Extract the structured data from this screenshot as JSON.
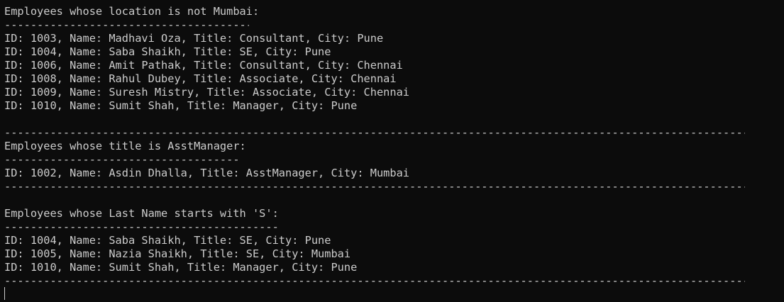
{
  "sections": {
    "not_mumbai": {
      "heading": "Employees whose location is not Mumbai:",
      "underline": "---------------------------------------",
      "rows": [
        "ID: 1003, Name: Madhavi Oza, Title: Consultant, City: Pune",
        "ID: 1004, Name: Saba Shaikh, Title: SE, City: Pune",
        "ID: 1006, Name: Amit Pathak, Title: Consultant, City: Chennai",
        "ID: 1008, Name: Rahul Dubey, Title: Associate, City: Chennai",
        "ID: 1009, Name: Suresh Mistry, Title: Associate, City: Chennai",
        "ID: 1010, Name: Sumit Shah, Title: Manager, City: Pune"
      ]
    },
    "asst_manager": {
      "heading": "Employees whose title is AsstManager:",
      "underline": "-------------------------------------",
      "rows": [
        "ID: 1002, Name: Asdin Dhalla, Title: AsstManager, City: Mumbai"
      ]
    },
    "last_name_s": {
      "heading": "Employees whose Last Name starts with 'S':",
      "underline": "------------------------------------------",
      "rows": [
        "ID: 1004, Name: Saba Shaikh, Title: SE, City: Pune",
        "ID: 1005, Name: Nazia Shaikh, Title: SE, City: Mumbai",
        "ID: 1010, Name: Sumit Shah, Title: Manager, City: Pune"
      ]
    }
  },
  "long_separator": "----------------------------------------------------------------------------------------------------------------------"
}
